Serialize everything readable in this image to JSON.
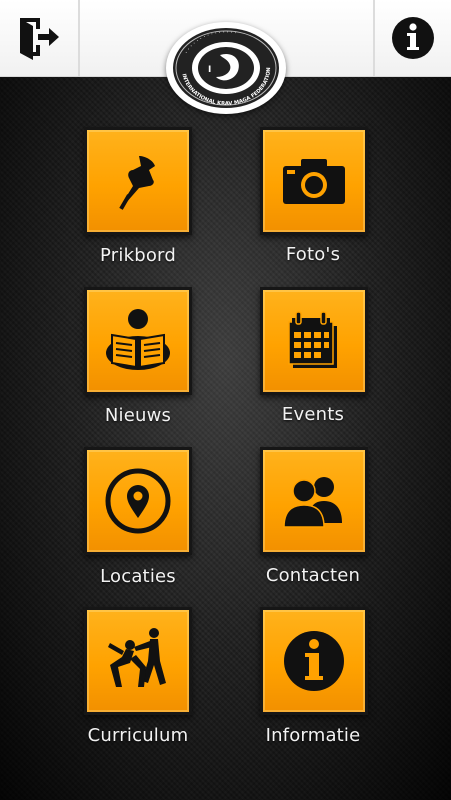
{
  "header": {
    "logout_icon": "logout-icon",
    "info_icon": "info-icon",
    "logo_text": "INTERNATIONAL KRAV MAGA FEDERATION"
  },
  "menu": [
    {
      "label": "Prikbord",
      "icon": "pushpin-icon"
    },
    {
      "label": "Foto's",
      "icon": "camera-icon"
    },
    {
      "label": "Nieuws",
      "icon": "newspaper-reader-icon"
    },
    {
      "label": "Events",
      "icon": "calendar-icon"
    },
    {
      "label": "Locaties",
      "icon": "location-pin-icon"
    },
    {
      "label": "Contacten",
      "icon": "contacts-icon"
    },
    {
      "label": "Curriculum",
      "icon": "fighters-icon"
    },
    {
      "label": "Informatie",
      "icon": "info-circle-icon"
    }
  ],
  "colors": {
    "tile": "#ffa200",
    "icon": "#111111",
    "label": "#f2f2f2"
  }
}
